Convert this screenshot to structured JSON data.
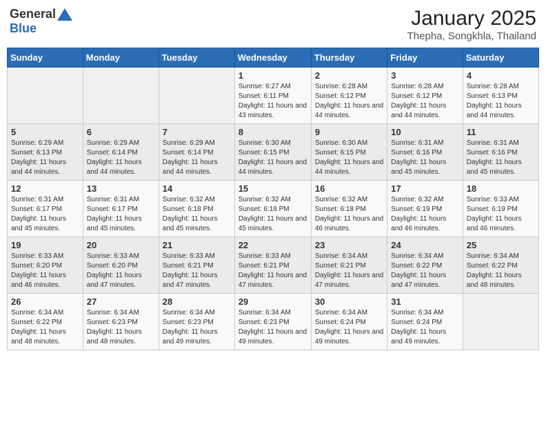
{
  "header": {
    "logo_general": "General",
    "logo_blue": "Blue",
    "month_title": "January 2025",
    "location": "Thepha, Songkhla, Thailand"
  },
  "days_of_week": [
    "Sunday",
    "Monday",
    "Tuesday",
    "Wednesday",
    "Thursday",
    "Friday",
    "Saturday"
  ],
  "weeks": [
    [
      {
        "day": "",
        "sunrise": "",
        "sunset": "",
        "daylight": ""
      },
      {
        "day": "",
        "sunrise": "",
        "sunset": "",
        "daylight": ""
      },
      {
        "day": "",
        "sunrise": "",
        "sunset": "",
        "daylight": ""
      },
      {
        "day": "1",
        "sunrise": "Sunrise: 6:27 AM",
        "sunset": "Sunset: 6:11 PM",
        "daylight": "Daylight: 11 hours and 43 minutes."
      },
      {
        "day": "2",
        "sunrise": "Sunrise: 6:28 AM",
        "sunset": "Sunset: 6:12 PM",
        "daylight": "Daylight: 11 hours and 44 minutes."
      },
      {
        "day": "3",
        "sunrise": "Sunrise: 6:28 AM",
        "sunset": "Sunset: 6:12 PM",
        "daylight": "Daylight: 11 hours and 44 minutes."
      },
      {
        "day": "4",
        "sunrise": "Sunrise: 6:28 AM",
        "sunset": "Sunset: 6:13 PM",
        "daylight": "Daylight: 11 hours and 44 minutes."
      }
    ],
    [
      {
        "day": "5",
        "sunrise": "Sunrise: 6:29 AM",
        "sunset": "Sunset: 6:13 PM",
        "daylight": "Daylight: 11 hours and 44 minutes."
      },
      {
        "day": "6",
        "sunrise": "Sunrise: 6:29 AM",
        "sunset": "Sunset: 6:14 PM",
        "daylight": "Daylight: 11 hours and 44 minutes."
      },
      {
        "day": "7",
        "sunrise": "Sunrise: 6:29 AM",
        "sunset": "Sunset: 6:14 PM",
        "daylight": "Daylight: 11 hours and 44 minutes."
      },
      {
        "day": "8",
        "sunrise": "Sunrise: 6:30 AM",
        "sunset": "Sunset: 6:15 PM",
        "daylight": "Daylight: 11 hours and 44 minutes."
      },
      {
        "day": "9",
        "sunrise": "Sunrise: 6:30 AM",
        "sunset": "Sunset: 6:15 PM",
        "daylight": "Daylight: 11 hours and 44 minutes."
      },
      {
        "day": "10",
        "sunrise": "Sunrise: 6:31 AM",
        "sunset": "Sunset: 6:16 PM",
        "daylight": "Daylight: 11 hours and 45 minutes."
      },
      {
        "day": "11",
        "sunrise": "Sunrise: 6:31 AM",
        "sunset": "Sunset: 6:16 PM",
        "daylight": "Daylight: 11 hours and 45 minutes."
      }
    ],
    [
      {
        "day": "12",
        "sunrise": "Sunrise: 6:31 AM",
        "sunset": "Sunset: 6:17 PM",
        "daylight": "Daylight: 11 hours and 45 minutes."
      },
      {
        "day": "13",
        "sunrise": "Sunrise: 6:31 AM",
        "sunset": "Sunset: 6:17 PM",
        "daylight": "Daylight: 11 hours and 45 minutes."
      },
      {
        "day": "14",
        "sunrise": "Sunrise: 6:32 AM",
        "sunset": "Sunset: 6:18 PM",
        "daylight": "Daylight: 11 hours and 45 minutes."
      },
      {
        "day": "15",
        "sunrise": "Sunrise: 6:32 AM",
        "sunset": "Sunset: 6:18 PM",
        "daylight": "Daylight: 11 hours and 45 minutes."
      },
      {
        "day": "16",
        "sunrise": "Sunrise: 6:32 AM",
        "sunset": "Sunset: 6:18 PM",
        "daylight": "Daylight: 11 hours and 46 minutes."
      },
      {
        "day": "17",
        "sunrise": "Sunrise: 6:32 AM",
        "sunset": "Sunset: 6:19 PM",
        "daylight": "Daylight: 11 hours and 46 minutes."
      },
      {
        "day": "18",
        "sunrise": "Sunrise: 6:33 AM",
        "sunset": "Sunset: 6:19 PM",
        "daylight": "Daylight: 11 hours and 46 minutes."
      }
    ],
    [
      {
        "day": "19",
        "sunrise": "Sunrise: 6:33 AM",
        "sunset": "Sunset: 6:20 PM",
        "daylight": "Daylight: 11 hours and 46 minutes."
      },
      {
        "day": "20",
        "sunrise": "Sunrise: 6:33 AM",
        "sunset": "Sunset: 6:20 PM",
        "daylight": "Daylight: 11 hours and 47 minutes."
      },
      {
        "day": "21",
        "sunrise": "Sunrise: 6:33 AM",
        "sunset": "Sunset: 6:21 PM",
        "daylight": "Daylight: 11 hours and 47 minutes."
      },
      {
        "day": "22",
        "sunrise": "Sunrise: 6:33 AM",
        "sunset": "Sunset: 6:21 PM",
        "daylight": "Daylight: 11 hours and 47 minutes."
      },
      {
        "day": "23",
        "sunrise": "Sunrise: 6:34 AM",
        "sunset": "Sunset: 6:21 PM",
        "daylight": "Daylight: 11 hours and 47 minutes."
      },
      {
        "day": "24",
        "sunrise": "Sunrise: 6:34 AM",
        "sunset": "Sunset: 6:22 PM",
        "daylight": "Daylight: 11 hours and 47 minutes."
      },
      {
        "day": "25",
        "sunrise": "Sunrise: 6:34 AM",
        "sunset": "Sunset: 6:22 PM",
        "daylight": "Daylight: 11 hours and 48 minutes."
      }
    ],
    [
      {
        "day": "26",
        "sunrise": "Sunrise: 6:34 AM",
        "sunset": "Sunset: 6:22 PM",
        "daylight": "Daylight: 11 hours and 48 minutes."
      },
      {
        "day": "27",
        "sunrise": "Sunrise: 6:34 AM",
        "sunset": "Sunset: 6:23 PM",
        "daylight": "Daylight: 11 hours and 48 minutes."
      },
      {
        "day": "28",
        "sunrise": "Sunrise: 6:34 AM",
        "sunset": "Sunset: 6:23 PM",
        "daylight": "Daylight: 11 hours and 49 minutes."
      },
      {
        "day": "29",
        "sunrise": "Sunrise: 6:34 AM",
        "sunset": "Sunset: 6:23 PM",
        "daylight": "Daylight: 11 hours and 49 minutes."
      },
      {
        "day": "30",
        "sunrise": "Sunrise: 6:34 AM",
        "sunset": "Sunset: 6:24 PM",
        "daylight": "Daylight: 11 hours and 49 minutes."
      },
      {
        "day": "31",
        "sunrise": "Sunrise: 6:34 AM",
        "sunset": "Sunset: 6:24 PM",
        "daylight": "Daylight: 11 hours and 49 minutes."
      },
      {
        "day": "",
        "sunrise": "",
        "sunset": "",
        "daylight": ""
      }
    ]
  ]
}
